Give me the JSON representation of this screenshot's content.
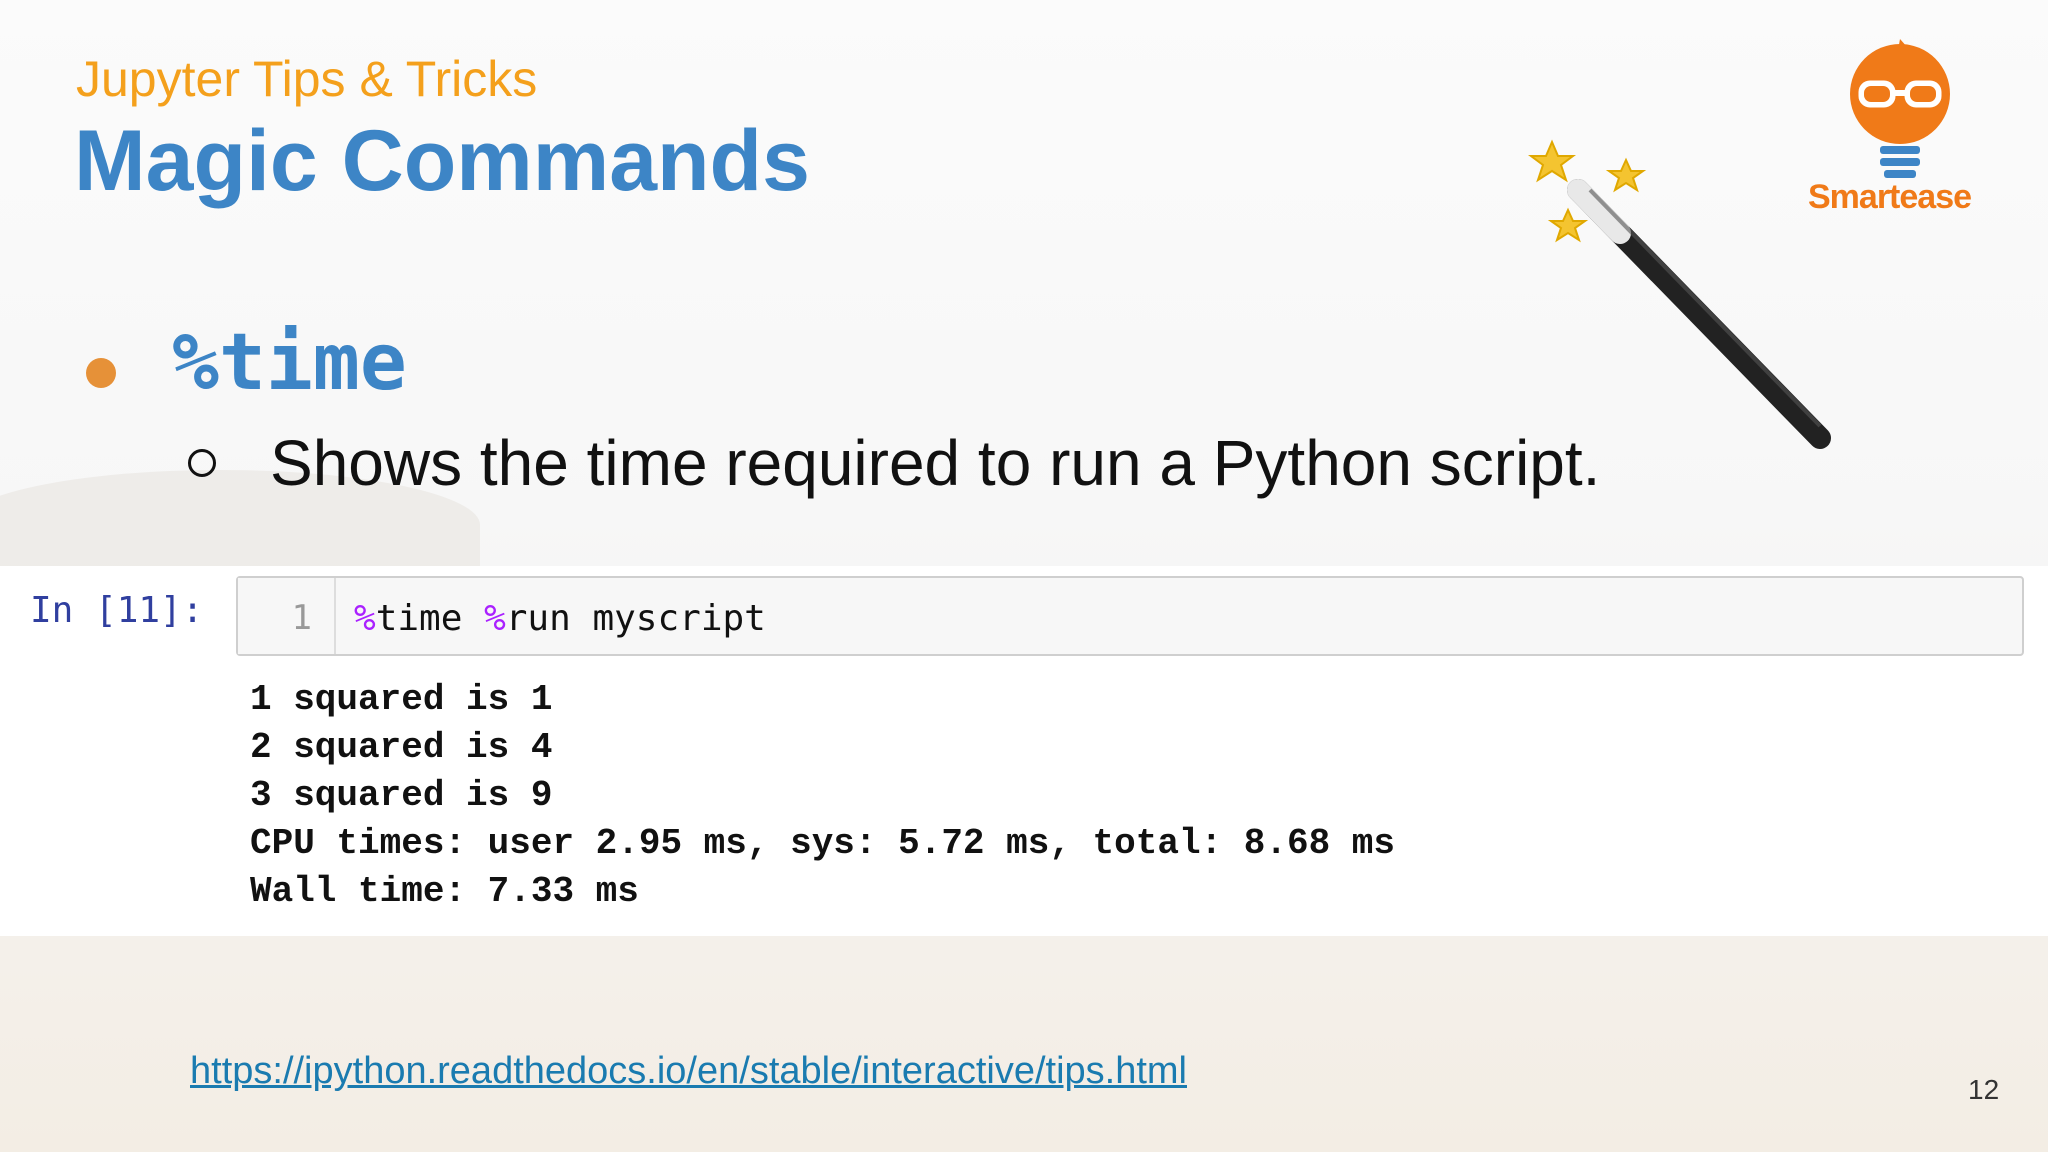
{
  "slide": {
    "subtitle": "Jupyter Tips & Tricks",
    "title": "Magic Commands",
    "bullet": "%time",
    "sub_bullet": "Shows the time required to run a Python script.",
    "logo_text": "Smartease",
    "link": "https://ipython.readthedocs.io/en/stable/interactive/tips.html",
    "page_number": "12"
  },
  "notebook": {
    "prompt": "In [11]:",
    "line_number": "1",
    "code": {
      "magic1": "%",
      "cmd1": "time ",
      "magic2": "%",
      "cmd2": "run myscript"
    },
    "output": [
      "1 squared is 1",
      "2 squared is 4",
      "3 squared is 9",
      "CPU times: user 2.95 ms, sys: 5.72 ms, total: 8.68 ms",
      "Wall time: 7.33 ms"
    ]
  },
  "colors": {
    "title": "#3d85c6",
    "subtitle": "#f4a01c",
    "bullet_dot": "#e69138",
    "magic_keyword": "#aa22ff",
    "link": "#1a7bb0",
    "logo": "#f07a18"
  },
  "icons": [
    "magic-wand-icon",
    "smartease-logo-icon"
  ]
}
